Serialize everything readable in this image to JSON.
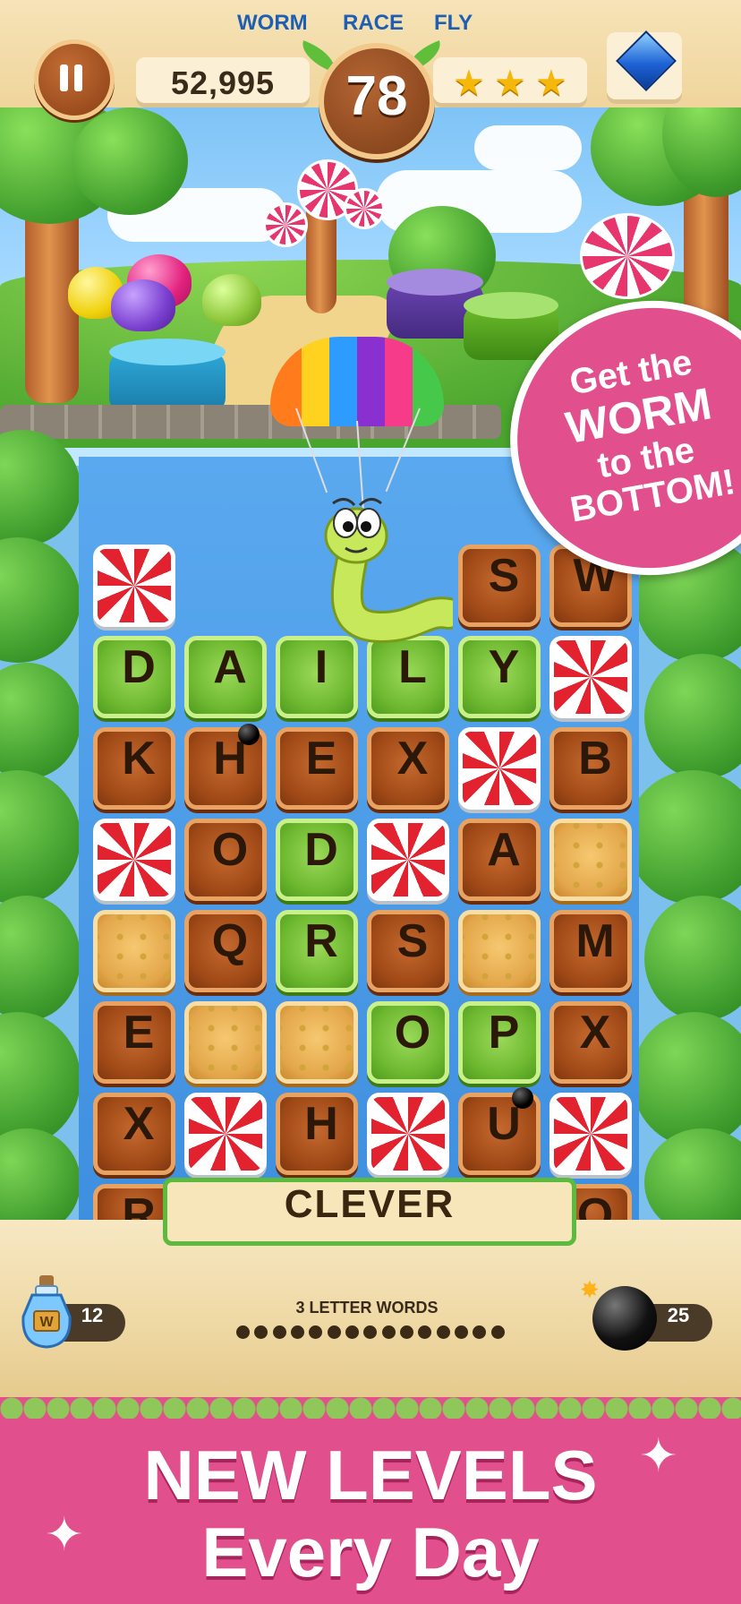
{
  "header": {
    "modes": [
      "WORM",
      "RACE",
      "FLY"
    ],
    "score": "52,995",
    "moves": "78",
    "stars_earned": 3
  },
  "promo_badge": {
    "line1": "Get the",
    "line2": "WORM",
    "line3": "to the",
    "line4": "BOTTOM!"
  },
  "board": {
    "rows": [
      [
        "mint",
        "",
        "",
        "",
        "S",
        "W"
      ],
      [
        "D",
        "A",
        "I",
        "L",
        "Y",
        "mint"
      ],
      [
        "K",
        "H",
        "E",
        "X",
        "mint",
        "B"
      ],
      [
        "mint",
        "O",
        "D",
        "mint",
        "A",
        "cookie"
      ],
      [
        "cookie",
        "Q",
        "R",
        "S",
        "cookie",
        "M"
      ],
      [
        "E",
        "cookie",
        "cookie",
        "O",
        "P",
        "X"
      ],
      [
        "X",
        "mint",
        "H",
        "mint",
        "U",
        "mint"
      ],
      [
        "R",
        "",
        "",
        "",
        "",
        "O"
      ]
    ],
    "green_tiles": [
      [
        1,
        0
      ],
      [
        1,
        1
      ],
      [
        1,
        2
      ],
      [
        1,
        3
      ],
      [
        1,
        4
      ],
      [
        3,
        2
      ],
      [
        4,
        2
      ],
      [
        5,
        3
      ],
      [
        5,
        4
      ]
    ]
  },
  "current_word": "CLEVER",
  "goal": {
    "label": "3 LETTER WORDS",
    "remaining_dots": 15
  },
  "powerups": {
    "potion_count": "12",
    "bomb_count": "25"
  },
  "banner": {
    "line1": "NEW LEVELS",
    "line2": "Every Day"
  }
}
